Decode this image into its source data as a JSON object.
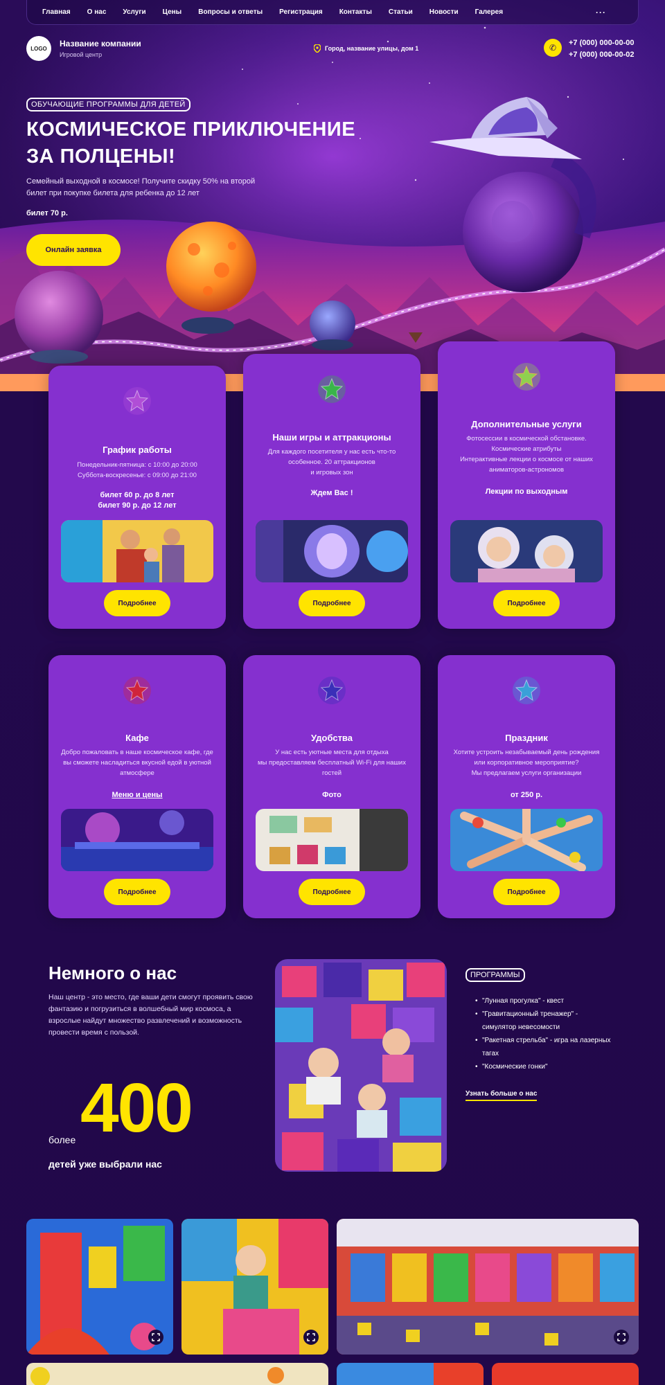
{
  "nav": {
    "items": [
      "Главная",
      "О нас",
      "Услуги",
      "Цены",
      "Вопросы и ответы",
      "Регистрация",
      "Контакты",
      "Статьи",
      "Новости",
      "Галерея"
    ],
    "more": "···"
  },
  "header": {
    "logo": "LOGO",
    "company_name": "Название компании",
    "company_sub": "Игровой центр",
    "address": "Город, название улицы, дом 1",
    "phone1": "+7 (000) 000-00-00",
    "phone2": "+7 (000) 000-00-02"
  },
  "hero": {
    "badge": "ОБУЧАЮЩИЕ ПРОГРАММЫ ДЛЯ ДЕТЕЙ",
    "title_line1": "КОСМИЧЕСКОЕ ПРИКЛЮЧЕНИЕ",
    "title_line2": "ЗА ПОЛЦЕНЫ!",
    "desc": "Семейный выходной в космосе! Получите скидку 50% на второй билет при покупке билета для ребенка до 12 лет",
    "price": "билет 70 р.",
    "button": "Онлайн заявка"
  },
  "cards": [
    {
      "title": "График работы",
      "text1": "Понедельник-пятница: с 10:00 до 20:00",
      "text2": "Суббота-воскресенье: с 09:00 до 21:00",
      "bold1": "билет 60 р.  до 8 лет",
      "bold2": "билет 90 р.  до 12 лет",
      "button": "Подробнее",
      "star": "#b04ed6"
    },
    {
      "title": "Наши игры и аттракционы",
      "text1": "Для каждого посетителя у нас есть что-то особенное. 20 аттракционов",
      "text2": "и игровых зон",
      "bold1": "Ждем Вас !",
      "button": "Подробнее",
      "star": "#39b54a"
    },
    {
      "title": "Дополнительные услуги",
      "text1": "Фотосессии в космической обстановке.",
      "text2": "Космические атрибуты",
      "text3": "Интерактивные лекции о космосе от наших аниматоров-астрономов",
      "bold1": "Лекции по выходным",
      "button": "Подробнее",
      "star": "#8fd14f"
    },
    {
      "title": "Кафе",
      "text1": "Добро пожаловать в наше космическое кафе, где вы сможете насладиться вкусной едой в уютной атмосфере",
      "link": "Меню и цены",
      "button": "Подробнее",
      "star": "#d0243c"
    },
    {
      "title": "Удобства",
      "text1": "У нас есть уютные места для отдыха",
      "text2": "мы предоставляем бесплатный Wi-Fi для наших гостей",
      "bold1": "Фото",
      "button": "Подробнее",
      "star": "#3a2fb8"
    },
    {
      "title": "Праздник",
      "text1": "Хотите устроить незабываемый день рождения или корпоративное мероприятие?",
      "text2": "Мы предлагаем услуги организации",
      "bold1": "от 250 р.",
      "button": "Подробнее",
      "star": "#3aa0d8"
    }
  ],
  "about": {
    "title": "Немного о нас",
    "text": "Наш центр - это место, где ваши дети смогут проявить свою фантазию и погрузиться в волшебный мир космоса, а взрослые найдут множество развлечений и возможность провести время с пользой.",
    "prefix": "более",
    "number": "400",
    "suffix": "детей уже выбрали нас",
    "programs_badge": "ПРОГРАММЫ",
    "programs": [
      "\"Лунная прогулка\" - квест",
      "\"Гравитационный тренажер\" - симулятор невесомости",
      "\"Ракетная стрельба\" - игра на лазерных тагах",
      "\"Космические гонки\""
    ],
    "learn_more": "Узнать больше  о нас"
  },
  "colors": {
    "accent": "#ffe400",
    "card": "#8530cf",
    "bg": "#22094b"
  }
}
